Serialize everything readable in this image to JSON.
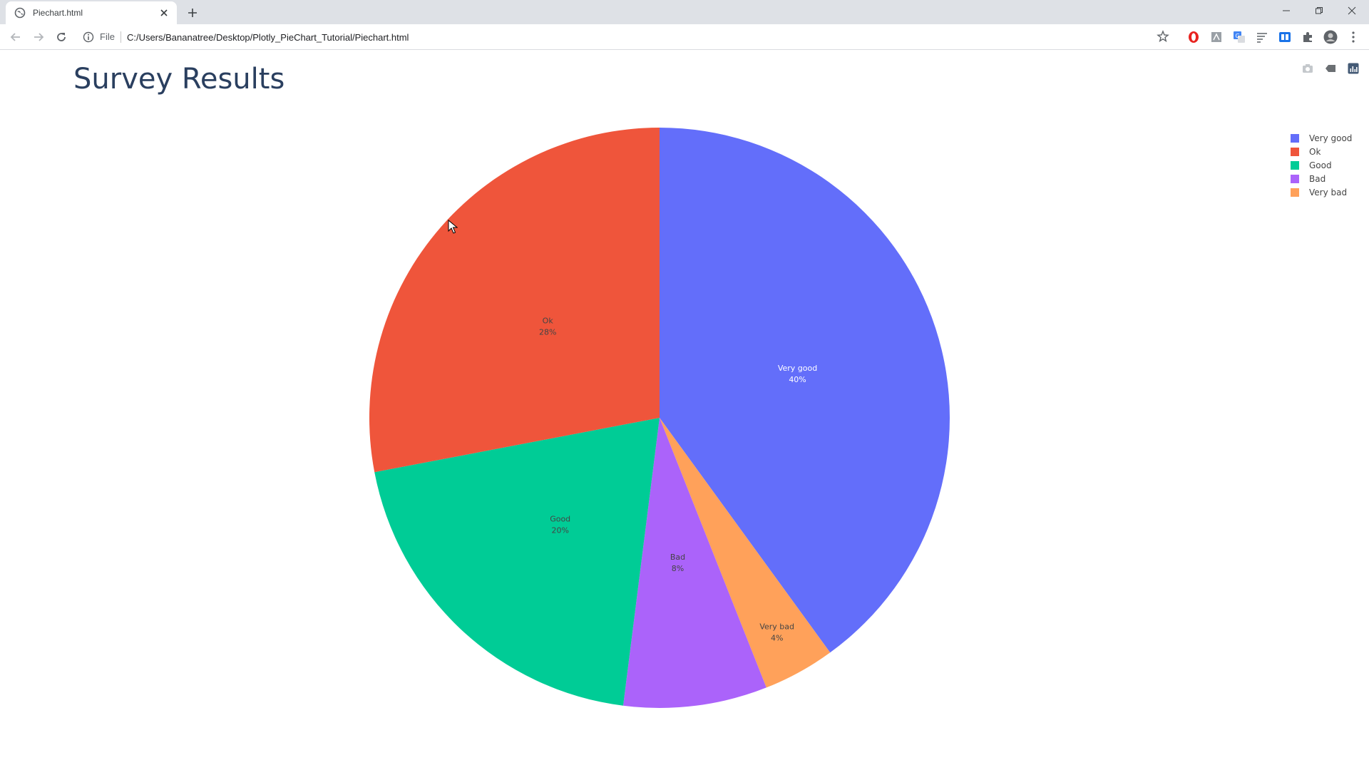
{
  "browser": {
    "tab_title": "Piechart.html",
    "scheme_label": "File",
    "url": "C:/Users/Bananatree/Desktop/Plotly_PieChart_Tutorial/Piechart.html"
  },
  "page": {
    "title": "Survey Results"
  },
  "colors": {
    "very_good": "#636efa",
    "ok": "#ef553b",
    "good": "#00cc96",
    "bad": "#ab63fa",
    "very_bad": "#ffa15a",
    "title_text": "#2a3f5f"
  },
  "chart_data": {
    "type": "pie",
    "title": "Survey Results",
    "slices": [
      {
        "label": "Very good",
        "value": 40,
        "percent_label": "40%",
        "color": "#636efa",
        "text_color": "#ffffff"
      },
      {
        "label": "Very bad",
        "value": 4,
        "percent_label": "4%",
        "color": "#ffa15a",
        "text_color": "#444444"
      },
      {
        "label": "Bad",
        "value": 8,
        "percent_label": "8%",
        "color": "#ab63fa",
        "text_color": "#444444"
      },
      {
        "label": "Good",
        "value": 20,
        "percent_label": "20%",
        "color": "#00cc96",
        "text_color": "#444444"
      },
      {
        "label": "Ok",
        "value": 28,
        "percent_label": "28%",
        "color": "#ef553b",
        "text_color": "#444444"
      }
    ],
    "legend": [
      "Very good",
      "Ok",
      "Good",
      "Bad",
      "Very bad"
    ],
    "legend_position": "top-right",
    "direction": "clockwise",
    "start": "top"
  }
}
